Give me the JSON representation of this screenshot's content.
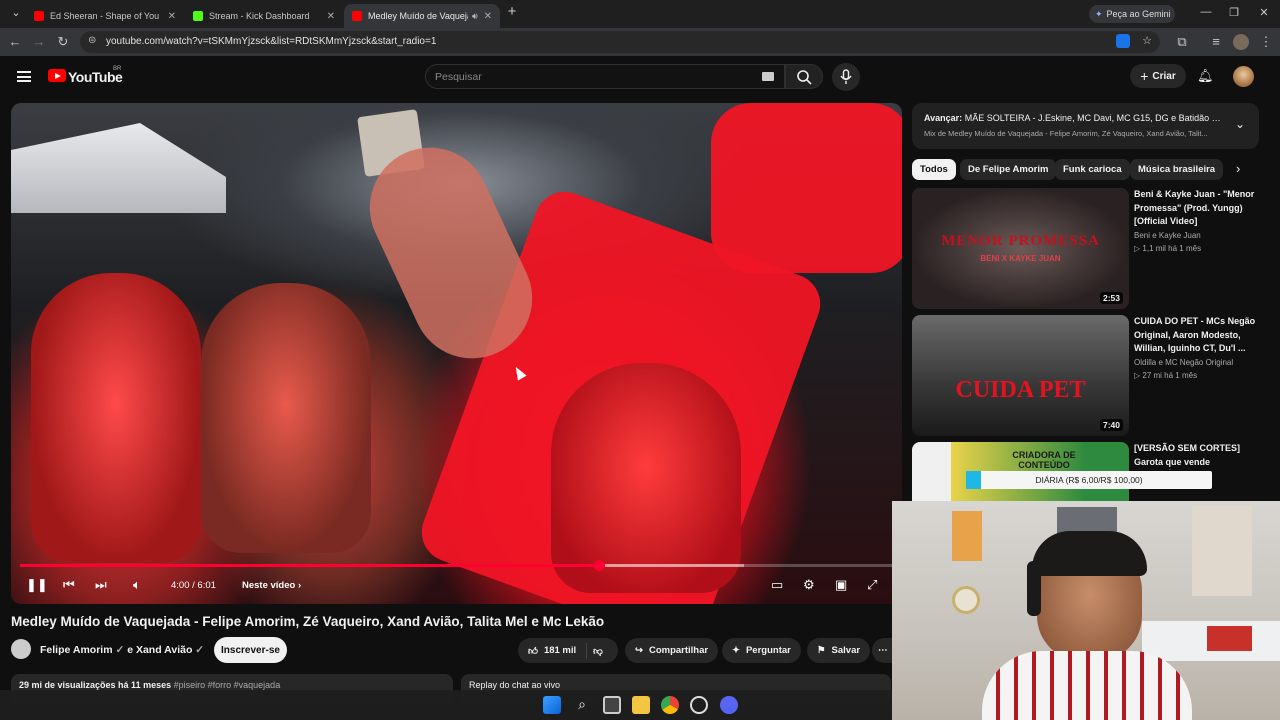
{
  "browser": {
    "tabs": [
      {
        "label": "Ed Sheeran - Shape of You 🔥 |",
        "favicon_color": "#ff0000",
        "active": false
      },
      {
        "label": "Stream - Kick Dashboard",
        "favicon_color": "#53fc18",
        "active": false
      },
      {
        "label": "Medley Muído de Vaquejada",
        "favicon_color": "#ff0000",
        "active": true
      }
    ],
    "new_tab_icon": "plus-icon",
    "gemini_label": "Peça ao Gemini",
    "url": "youtube.com/watch?v=tSKMmYjzsck&list=RDtSKMmYjzsck&start_radio=1"
  },
  "youtube": {
    "logo_text": "YouTube",
    "region": "BR",
    "search_placeholder": "Pesquisar",
    "create_label": "Criar"
  },
  "player": {
    "time": "4:00 / 6:01",
    "next_label": "Neste vídeo",
    "progress_fraction": 0.664,
    "buffered_fraction": 0.83,
    "accent": "#ff0033"
  },
  "video": {
    "title": "Medley Muído de Vaquejada - Felipe Amorim, Zé Vaqueiro, Xand Avião, Talita Mel e Mc Lekão",
    "channel": "Felipe Amorim",
    "channel_joiner": "e Xand Avião",
    "subscribe_label": "Inscrever-se",
    "likes": "181 mil",
    "share_label": "Compartilhar",
    "ask_label": "Perguntar",
    "save_label": "Salvar",
    "stats": "29 mi de visualizações  há 11 meses",
    "tags": "#piseiro #forro #vaquejada",
    "replay_label": "Replay do chat ao vivo"
  },
  "mix": {
    "next_prefix": "Avançar:",
    "next_title": "MÃE SOLTEIRA - J.Eskine, MC Davi, MC G15, DG e Batidão St...",
    "subtitle": "Mix de Medley Muído de Vaquejada - Felipe Amorim, Zé Vaqueiro, Xand Avião, Talit..."
  },
  "chips": [
    "Todos",
    "De Felipe Amorim",
    "Funk carioca",
    "Música brasileira"
  ],
  "recommendations": [
    {
      "title": "Beni & Kayke Juan - \"Menor Promessa\" (Prod. Yungg) [Official Video]",
      "channel": "Beni      e Kayke Juan",
      "meta": "1,1 mil  há 1 mês",
      "duration": "2:53",
      "thumb_text": "MENOR PROMESSA",
      "thumb_sub": "BENI X KAYKE JUAN"
    },
    {
      "title": "CUIDA DO PET - MCs Negão Original, Aaron Modesto, Willian, Iguinho CT, Du'l ...",
      "channel": "Oldilla  e MC Negão Original",
      "meta": "27 mi  há 1 mês",
      "duration": "7:40",
      "thumb_text": "CUIDA PET"
    },
    {
      "title": "[VERSÃO SEM CORTES] Garota que vende CONTEÚDO",
      "channel": "",
      "meta": "",
      "duration": "",
      "thumb_text": "CRIADORA DE CONTEÚDO"
    }
  ],
  "overlay": {
    "donation_label": "DIÁRIA (R$ 6,00/R$ 100,00)",
    "donation_fraction": 0.06
  }
}
